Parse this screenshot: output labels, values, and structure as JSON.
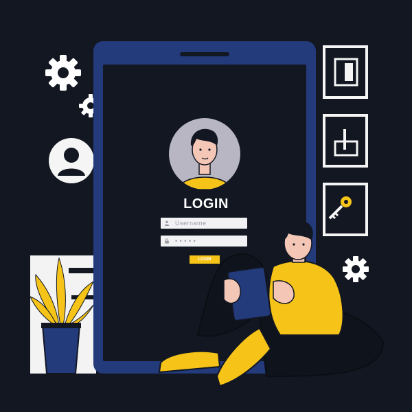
{
  "login_screen": {
    "title": "LOGIN",
    "username_placeholder": "Username",
    "password_mask": "• • • • •",
    "button_label": "LOGIN"
  },
  "colors": {
    "background": "#121722",
    "phone_frame": "#233a7b",
    "accent_yellow": "#f6c418",
    "white": "#f5f5f5"
  },
  "icons": [
    "gear-icon",
    "user-icon",
    "key-icon",
    "lock-icon"
  ]
}
